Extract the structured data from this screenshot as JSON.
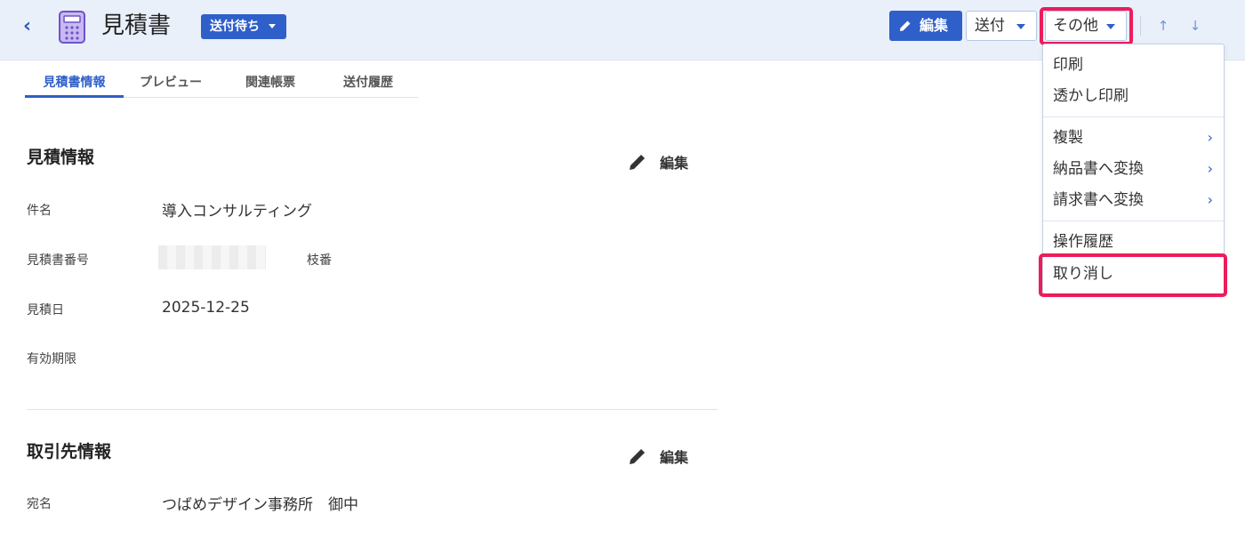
{
  "header": {
    "title": "見積書",
    "status": "送付待ち",
    "edit_label": "編集",
    "send_label": "送付",
    "more_label": "その他",
    "up_arrow": "↑",
    "down_arrow": "↓"
  },
  "tabs": [
    "見積書情報",
    "プレビュー",
    "関連帳票",
    "送付履歴"
  ],
  "estimate_section": {
    "title": "見積情報",
    "edit_label": "編集",
    "fields": {
      "subject_label": "件名",
      "subject_value": "導入コンサルティング",
      "number_label": "見積書番号",
      "branch_label": "枝番",
      "date_label": "見積日",
      "date_value": "2025-12-25",
      "expiry_label": "有効期限"
    }
  },
  "client_section": {
    "title": "取引先情報",
    "edit_label": "編集",
    "addressee_label": "宛名",
    "addressee_value": "つばめデザイン事務所　御中"
  },
  "menu": {
    "print": "印刷",
    "watermark_print": "透かし印刷",
    "duplicate": "複製",
    "to_delivery": "納品書へ変換",
    "to_invoice": "請求書へ変換",
    "history": "操作履歴",
    "cancel": "取り消し"
  },
  "colors": {
    "accent": "#2f5fc9",
    "highlight": "#ec1c5b",
    "header_bg": "#eaf0fa"
  }
}
